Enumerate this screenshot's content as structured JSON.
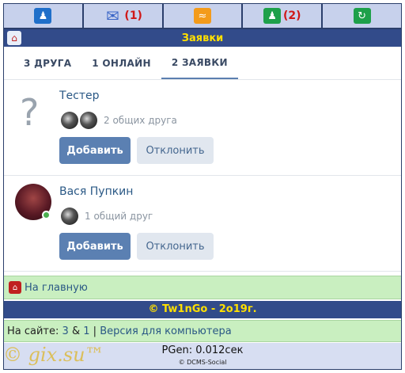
{
  "topnav": {
    "items": [
      {
        "icon": "user-icon",
        "count": ""
      },
      {
        "icon": "envelope-icon",
        "count": "(1)"
      },
      {
        "icon": "rss-icon",
        "count": ""
      },
      {
        "icon": "friends-icon",
        "count": "(2)"
      },
      {
        "icon": "refresh-icon",
        "count": ""
      }
    ]
  },
  "header": {
    "title": "Заявки"
  },
  "tabs": [
    {
      "label": "3 ДРУГА",
      "active": false
    },
    {
      "label": "1 ОНЛАЙН",
      "active": false
    },
    {
      "label": "2 ЗАЯВКИ",
      "active": true
    }
  ],
  "requests": [
    {
      "name": "Тестер",
      "avatar": "?",
      "mutual": "2 общих друга",
      "add_label": "Добавить",
      "decline_label": "Отклонить"
    },
    {
      "name": "Вася Пупкин",
      "mutual": "1 общий друг",
      "add_label": "Добавить",
      "decline_label": "Отклонить"
    }
  ],
  "footer": {
    "home_link": "На главную",
    "copyright": "© Tw1nGo - 2o19г.",
    "online_prefix": "На сайте:",
    "online_count_1": "3",
    "online_amp": "&",
    "online_count_2": "1",
    "online_sep": "|",
    "desktop_link": "Версия для компьютера",
    "pgen": "PGen: 0.012сек",
    "engine": "© DCMS-Social",
    "watermark": "© gix.su™"
  },
  "colors": {
    "nav_bar": "#324b8a",
    "title_text": "#ffe000",
    "green_panel": "#c9efc0",
    "add_button": "#5b80b2",
    "link": "#2a5885"
  }
}
